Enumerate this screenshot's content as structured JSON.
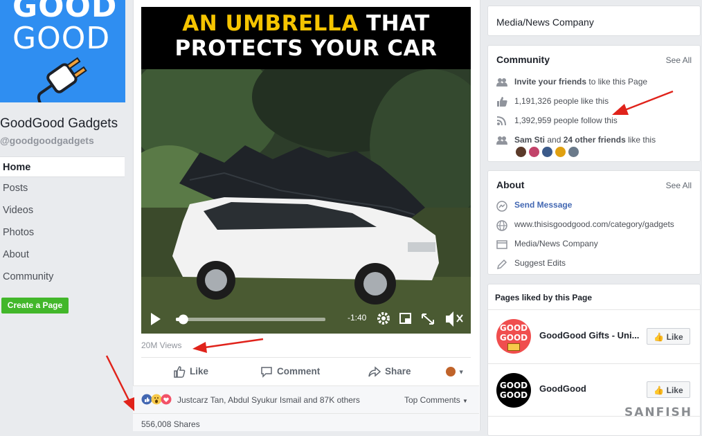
{
  "page": {
    "logo_text_1": "GOOD",
    "logo_text_2": "GOOD",
    "name": "GoodGood Gadgets",
    "handle": "@goodgoodgadgets",
    "nav": [
      "Home",
      "Posts",
      "Videos",
      "Photos",
      "About",
      "Community"
    ],
    "create_page": "Create a Page"
  },
  "post": {
    "video_title_highlight": "AN UMBRELLA",
    "video_title_rest": " THAT",
    "video_title_line2": "PROTECTS YOUR CAR",
    "time_remaining": "-1:40",
    "video_progress": 0.05,
    "views": "20M Views",
    "like": "Like",
    "comment": "Comment",
    "share": "Share",
    "reactors": "Justcarz Tan, Abdul Syukur Ismail and 87K others",
    "top_comments": "Top Comments",
    "shares": "556,008 Shares"
  },
  "sidebar": {
    "category_top": "Media/News Company",
    "community": {
      "title": "Community",
      "see_all": "See All",
      "invite_bold": "Invite your friends",
      "invite_rest": " to like this Page",
      "likes": "1,191,326 people like this",
      "follows": "1,392,959 people follow this",
      "friends_name": "Sam Sti",
      "friends_and": " and ",
      "friends_bold": "24 other friends",
      "friends_rest": " like this"
    },
    "about": {
      "title": "About",
      "see_all": "See All",
      "send_message": "Send Message",
      "website": "www.thisisgoodgood.com/category/gadgets",
      "category": "Media/News Company",
      "suggest_edits": "Suggest Edits"
    },
    "pages_liked": {
      "title": "Pages liked by this Page",
      "items": [
        {
          "name": "GoodGood Gifts - Uni...",
          "like": "Like",
          "logo_line1": "GOOD",
          "logo_line2": "GOOD"
        },
        {
          "name": "GoodGood",
          "like": "Like",
          "logo_line1": "GOOD",
          "logo_line2": "GOOD"
        }
      ]
    }
  },
  "watermark": "SANFISH",
  "colors": {
    "accent": "#4267b2",
    "green": "#42b72a",
    "logo_blue": "#2f8ef1",
    "arrow_red": "#e0231b"
  }
}
